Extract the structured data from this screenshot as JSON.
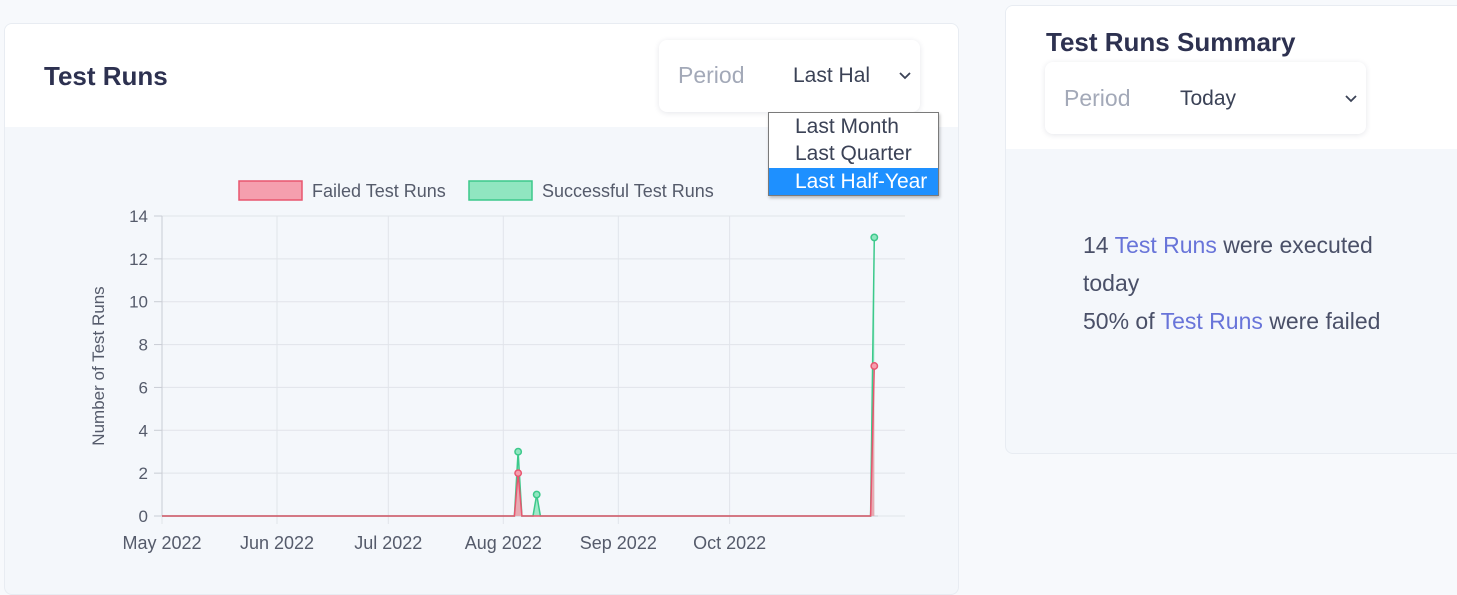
{
  "left_card": {
    "title": "Test Runs",
    "period_label": "Period",
    "period_value": "Last Hal",
    "dropdown_options": [
      "Last Month",
      "Last Quarter",
      "Last Half-Year"
    ],
    "selected_option_index": 2
  },
  "right_card": {
    "title": "Test Runs Summary",
    "period_label": "Period",
    "period_value": "Today",
    "summary": {
      "count": "14",
      "link1": "Test Runs",
      "text1": "were executed today",
      "percent": "50% of",
      "link2": "Test Runs",
      "text2": "were failed"
    }
  },
  "chart_data": {
    "type": "area",
    "ylabel": "Number of Test Runs",
    "xlabel": "",
    "ylim": [
      0,
      14
    ],
    "y_ticks": [
      0,
      2,
      4,
      6,
      8,
      10,
      12,
      14
    ],
    "x_range": [
      "2022-05-01",
      "2022-11-10"
    ],
    "x_ticks": [
      {
        "date": "2022-05-01",
        "label": "May 2022"
      },
      {
        "date": "2022-06-01",
        "label": "Jun 2022"
      },
      {
        "date": "2022-07-01",
        "label": "Jul 2022"
      },
      {
        "date": "2022-08-01",
        "label": "Aug 2022"
      },
      {
        "date": "2022-09-01",
        "label": "Sep 2022"
      },
      {
        "date": "2022-10-01",
        "label": "Oct 2022"
      }
    ],
    "grid": true,
    "legend_position": "top",
    "series": [
      {
        "name": "Failed Test Runs",
        "color": "#e8566f",
        "fill": "#f59fae",
        "points": [
          {
            "x": "2022-05-01",
            "y": 0
          },
          {
            "x": "2022-08-04",
            "y": 0
          },
          {
            "x": "2022-08-05",
            "y": 2
          },
          {
            "x": "2022-08-06",
            "y": 0
          },
          {
            "x": "2022-11-08",
            "y": 0
          },
          {
            "x": "2022-11-09",
            "y": 7
          }
        ]
      },
      {
        "name": "Successful Test Runs",
        "color": "#3cc98b",
        "fill": "#90e6c0",
        "points": [
          {
            "x": "2022-05-01",
            "y": 0
          },
          {
            "x": "2022-08-04",
            "y": 0
          },
          {
            "x": "2022-08-05",
            "y": 3
          },
          {
            "x": "2022-08-06",
            "y": 0
          },
          {
            "x": "2022-08-09",
            "y": 0
          },
          {
            "x": "2022-08-10",
            "y": 1
          },
          {
            "x": "2022-08-11",
            "y": 0
          },
          {
            "x": "2022-11-08",
            "y": 0
          },
          {
            "x": "2022-11-09",
            "y": 13
          }
        ]
      }
    ]
  }
}
